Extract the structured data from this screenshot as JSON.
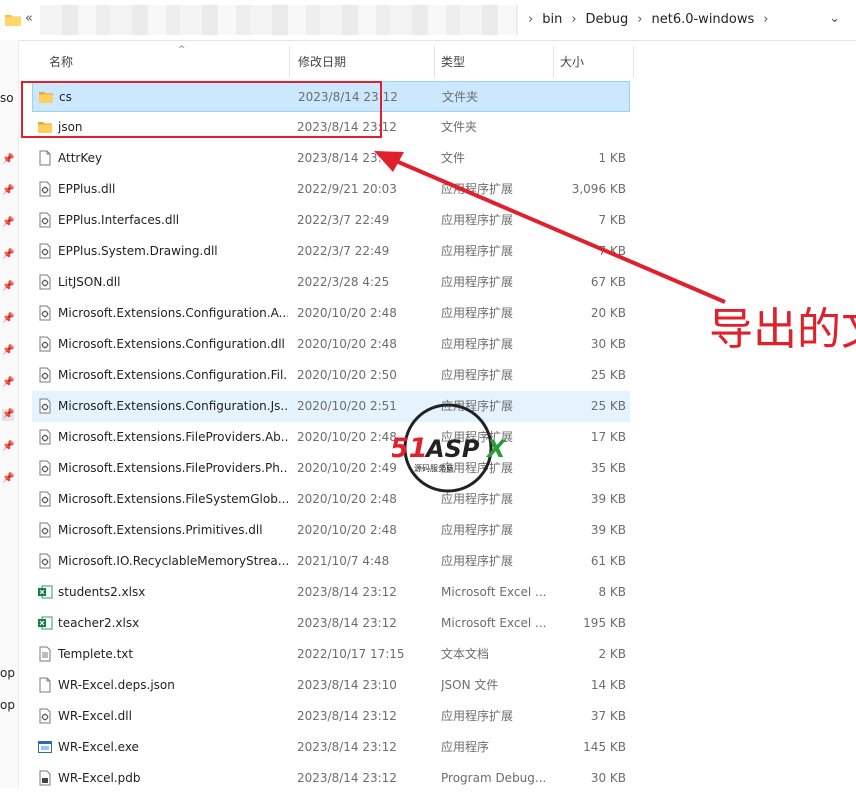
{
  "address": {
    "overflow": "«",
    "crumbs": [
      "bin",
      "Debug",
      "net6.0-windows"
    ]
  },
  "nav": {
    "labels": [
      "so",
      "op",
      "op"
    ]
  },
  "columns": [
    "名称",
    "修改日期",
    "类型",
    "大小"
  ],
  "files": [
    {
      "name": "cs",
      "date": "2023/8/14 23:12",
      "type": "文件夹",
      "size": "",
      "icon": "folder-icon",
      "state": "selected"
    },
    {
      "name": "json",
      "date": "2023/8/14 23:12",
      "type": "文件夹",
      "size": "",
      "icon": "folder-icon",
      "state": ""
    },
    {
      "name": "AttrKey",
      "date": "2023/8/14 23:04",
      "type": "文件",
      "size": "1 KB",
      "icon": "file-icon",
      "state": ""
    },
    {
      "name": "EPPlus.dll",
      "date": "2022/9/21 20:03",
      "type": "应用程序扩展",
      "size": "3,096 KB",
      "icon": "dll-icon",
      "state": ""
    },
    {
      "name": "EPPlus.Interfaces.dll",
      "date": "2022/3/7 22:49",
      "type": "应用程序扩展",
      "size": "7 KB",
      "icon": "dll-icon",
      "state": ""
    },
    {
      "name": "EPPlus.System.Drawing.dll",
      "date": "2022/3/7 22:49",
      "type": "应用程序扩展",
      "size": "7 KB",
      "icon": "dll-icon",
      "state": ""
    },
    {
      "name": "LitJSON.dll",
      "date": "2022/3/28 4:25",
      "type": "应用程序扩展",
      "size": "67 KB",
      "icon": "dll-icon",
      "state": ""
    },
    {
      "name": "Microsoft.Extensions.Configuration.A...",
      "date": "2020/10/20 2:48",
      "type": "应用程序扩展",
      "size": "20 KB",
      "icon": "dll-icon",
      "state": ""
    },
    {
      "name": "Microsoft.Extensions.Configuration.dll",
      "date": "2020/10/20 2:48",
      "type": "应用程序扩展",
      "size": "30 KB",
      "icon": "dll-icon",
      "state": ""
    },
    {
      "name": "Microsoft.Extensions.Configuration.Fil...",
      "date": "2020/10/20 2:50",
      "type": "应用程序扩展",
      "size": "25 KB",
      "icon": "dll-icon",
      "state": ""
    },
    {
      "name": "Microsoft.Extensions.Configuration.Js...",
      "date": "2020/10/20 2:51",
      "type": "应用程序扩展",
      "size": "25 KB",
      "icon": "dll-icon",
      "state": "hover"
    },
    {
      "name": "Microsoft.Extensions.FileProviders.Ab...",
      "date": "2020/10/20 2:48",
      "type": "应用程序扩展",
      "size": "17 KB",
      "icon": "dll-icon",
      "state": ""
    },
    {
      "name": "Microsoft.Extensions.FileProviders.Ph...",
      "date": "2020/10/20 2:49",
      "type": "应用程序扩展",
      "size": "35 KB",
      "icon": "dll-icon",
      "state": ""
    },
    {
      "name": "Microsoft.Extensions.FileSystemGlob...",
      "date": "2020/10/20 2:48",
      "type": "应用程序扩展",
      "size": "39 KB",
      "icon": "dll-icon",
      "state": ""
    },
    {
      "name": "Microsoft.Extensions.Primitives.dll",
      "date": "2020/10/20 2:48",
      "type": "应用程序扩展",
      "size": "39 KB",
      "icon": "dll-icon",
      "state": ""
    },
    {
      "name": "Microsoft.IO.RecyclableMemoryStrea...",
      "date": "2021/10/7 4:48",
      "type": "应用程序扩展",
      "size": "61 KB",
      "icon": "dll-icon",
      "state": ""
    },
    {
      "name": "students2.xlsx",
      "date": "2023/8/14 23:12",
      "type": "Microsoft Excel ...",
      "size": "8 KB",
      "icon": "excel-icon",
      "state": ""
    },
    {
      "name": "teacher2.xlsx",
      "date": "2023/8/14 23:12",
      "type": "Microsoft Excel ...",
      "size": "195 KB",
      "icon": "excel-icon",
      "state": ""
    },
    {
      "name": "Templete.txt",
      "date": "2022/10/17 17:15",
      "type": "文本文档",
      "size": "2 KB",
      "icon": "text-file-icon",
      "state": ""
    },
    {
      "name": "WR-Excel.deps.json",
      "date": "2023/8/14 23:10",
      "type": "JSON 文件",
      "size": "14 KB",
      "icon": "file-icon",
      "state": ""
    },
    {
      "name": "WR-Excel.dll",
      "date": "2023/8/14 23:12",
      "type": "应用程序扩展",
      "size": "37 KB",
      "icon": "dll-icon",
      "state": ""
    },
    {
      "name": "WR-Excel.exe",
      "date": "2023/8/14 23:12",
      "type": "应用程序",
      "size": "145 KB",
      "icon": "exe-icon",
      "state": ""
    },
    {
      "name": "WR-Excel.pdb",
      "date": "2023/8/14 23:12",
      "type": "Program Debug...",
      "size": "30 KB",
      "icon": "pdb-icon",
      "state": ""
    }
  ],
  "annotation": {
    "text": "导出的文",
    "color": "#e0212b"
  },
  "watermark": {
    "brand": "51ASPX",
    "tagline": "源码服务商"
  },
  "colors": {
    "selected_bg": "#cce8ff",
    "hover_bg": "#e5f3ff",
    "accent_red": "#e0212b",
    "folder": "#f2c14e"
  }
}
